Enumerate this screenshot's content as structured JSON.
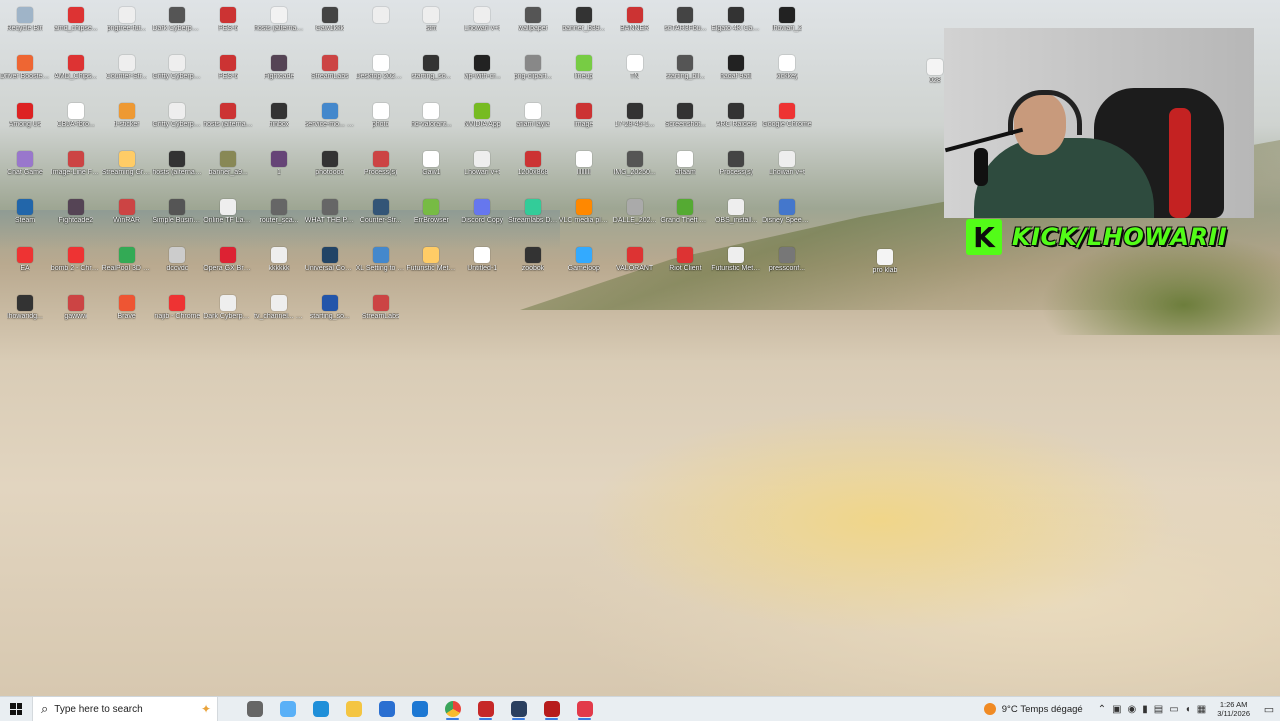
{
  "desktop": {
    "icons": [
      {
        "label": "Recycle Bin",
        "color": "#9fb4c8"
      },
      {
        "label": "amd_chipse...",
        "color": "#d33"
      },
      {
        "label": "pngtree-fut...",
        "color": "#eee"
      },
      {
        "label": "Dark Cyberpunk",
        "color": "#555"
      },
      {
        "label": "PES-6",
        "color": "#c33"
      },
      {
        "label": "hosts (alternative...",
        "color": "#f2f2f2"
      },
      {
        "label": "Gaw1kkk",
        "color": "#444"
      },
      {
        "label": "",
        "color": "#eee"
      },
      {
        "label": "stm",
        "color": "#eee"
      },
      {
        "label": "Lhowari v+t",
        "color": "#eee"
      },
      {
        "label": "wallpaper",
        "color": "#555"
      },
      {
        "label": "banner_b39...",
        "color": "#333"
      },
      {
        "label": "BANNER",
        "color": "#c33"
      },
      {
        "label": "scTAR3Fbu...",
        "color": "#444"
      },
      {
        "label": "Elgato 4K Captur...",
        "color": "#333"
      },
      {
        "label": "lhowari_2",
        "color": "#222"
      },
      {
        "label": "Driver Booster 12",
        "color": "#e63"
      },
      {
        "label": "AMD_Chips...",
        "color": "#d33"
      },
      {
        "label": "Counter-Str...",
        "color": "#eee"
      },
      {
        "label": "Gritty Cyberpunk",
        "color": "#eee"
      },
      {
        "label": "PES-6",
        "color": "#c33"
      },
      {
        "label": "Fightcade",
        "color": "#545"
      },
      {
        "label": "StreamLabs",
        "color": "#c44"
      },
      {
        "label": "Desktop 2025.04.0...",
        "color": "#fff"
      },
      {
        "label": "starting_so...",
        "color": "#333"
      },
      {
        "label": "vip-with-cr...",
        "color": "#222"
      },
      {
        "label": "png-clipart...",
        "color": "#888"
      },
      {
        "label": "lineup",
        "color": "#7c4"
      },
      {
        "label": "TN",
        "color": "#fff"
      },
      {
        "label": "starting_bil...",
        "color": "#555"
      },
      {
        "label": "hadaf 9atil",
        "color": "#222"
      },
      {
        "label": "kickkey",
        "color": "#fff"
      },
      {
        "label": "Among Us",
        "color": "#d22"
      },
      {
        "label": "CBJA-fbro...",
        "color": "#fff"
      },
      {
        "label": "tl-sticker",
        "color": "#e93"
      },
      {
        "label": "Gritty Cyberpunk...",
        "color": "#eee"
      },
      {
        "label": "hosts (alternative...",
        "color": "#c33"
      },
      {
        "label": "hinbox",
        "color": "#333"
      },
      {
        "label": "service-mo... (1)",
        "color": "#48c"
      },
      {
        "label": "photo",
        "color": "#fff"
      },
      {
        "label": "hd-valorant...",
        "color": "#fff"
      },
      {
        "label": "NVIDIA App",
        "color": "#7b2"
      },
      {
        "label": "aflam layla",
        "color": "#fff"
      },
      {
        "label": "image",
        "color": "#c33"
      },
      {
        "label": "17-28-45-1...",
        "color": "#333"
      },
      {
        "label": "Screenshot...",
        "color": "#333"
      },
      {
        "label": "ARC Raiders",
        "color": "#333"
      },
      {
        "label": "Google Chrome",
        "color": "#e33"
      },
      {
        "label": "Chat Game",
        "color": "#97c"
      },
      {
        "label": "Image-Line FL Studio",
        "color": "#c44"
      },
      {
        "label": "Streaming Grid Island",
        "color": "#fc6"
      },
      {
        "label": "hosts (alternative...",
        "color": "#333"
      },
      {
        "label": "banner_a9...",
        "color": "#885"
      },
      {
        "label": "1",
        "color": "#647"
      },
      {
        "label": "photoooo",
        "color": "#333"
      },
      {
        "label": "Process(s)",
        "color": "#c44"
      },
      {
        "label": "Gaw1",
        "color": "#fff"
      },
      {
        "label": "Lhowari v+t",
        "color": "#eee"
      },
      {
        "label": "1200x868",
        "color": "#c33"
      },
      {
        "label": "lllllllll",
        "color": "#fff"
      },
      {
        "label": "IMG_20250...",
        "color": "#555"
      },
      {
        "label": "aflaam",
        "color": "#fff"
      },
      {
        "label": "Process(s)",
        "color": "#444"
      },
      {
        "label": "Lhowari v+t",
        "color": "#eee"
      },
      {
        "label": "Steam",
        "color": "#26a"
      },
      {
        "label": "Fightcade2",
        "color": "#545"
      },
      {
        "label": "WinRAR",
        "color": "#c44"
      },
      {
        "label": "Simple Business Te...",
        "color": "#555"
      },
      {
        "label": "Online TF Launcher",
        "color": "#eee"
      },
      {
        "label": "router_sca...",
        "color": "#666"
      },
      {
        "label": "WHAT THE PAK",
        "color": "#666"
      },
      {
        "label": "Counter-Str...",
        "color": "#357"
      },
      {
        "label": "ErrBrowser",
        "color": "#7b4"
      },
      {
        "label": "Discord Copy",
        "color": "#67e"
      },
      {
        "label": "Streamlabs Desktop",
        "color": "#3c9"
      },
      {
        "label": "VLC media player",
        "color": "#f80"
      },
      {
        "label": "DALLE_202...",
        "color": "#aaa"
      },
      {
        "label": "Grand Theft Auto V Le...",
        "color": "#5a3"
      },
      {
        "label": "OBS_install...",
        "color": "#eee"
      },
      {
        "label": "Disney Speedstorm",
        "color": "#47c"
      },
      {
        "label": "EA",
        "color": "#e33"
      },
      {
        "label": "bomb 2 - Chrome",
        "color": "#e33"
      },
      {
        "label": "RealPool 3D - Poolians",
        "color": "#3a5"
      },
      {
        "label": "dccvdc",
        "color": "#ccc"
      },
      {
        "label": "Opera GX Browser",
        "color": "#d23"
      },
      {
        "label": "kkkkkk",
        "color": "#eee"
      },
      {
        "label": "Universal Control",
        "color": "#246"
      },
      {
        "label": "XL Setting to Share_v1.0...",
        "color": "#48c"
      },
      {
        "label": "Futuristic Metal Corn...",
        "color": "#fc6"
      },
      {
        "label": "Untitled-1",
        "color": "#fff"
      },
      {
        "label": "zoobok",
        "color": "#333"
      },
      {
        "label": "Gameloop",
        "color": "#3af"
      },
      {
        "label": "VALORANT",
        "color": "#d33"
      },
      {
        "label": "Riot Client",
        "color": "#d33"
      },
      {
        "label": "Futuristic Metal Corn...",
        "color": "#eee"
      },
      {
        "label": "pressconf...",
        "color": "#777"
      },
      {
        "label": "lhowaridg...",
        "color": "#333"
      },
      {
        "label": "gawww",
        "color": "#c44"
      },
      {
        "label": "Brave",
        "color": "#e53"
      },
      {
        "label": "najib - Chrome",
        "color": "#e33"
      },
      {
        "label": "Dark Cyberpunk",
        "color": "#eee"
      },
      {
        "label": "tv_channel... (1)",
        "color": "#eee"
      },
      {
        "label": "starting_so...",
        "color": "#25a"
      },
      {
        "label": "StreamLabs",
        "color": "#c44"
      }
    ],
    "extra_labels": [
      "pro klab",
      "028"
    ]
  },
  "stream_overlay": {
    "logo_letter": "K",
    "text": "KICK/LHOWARII"
  },
  "taskbar": {
    "search_placeholder": "Type here to search",
    "apps": [
      {
        "name": "task-view-icon",
        "color": "#666",
        "active": false
      },
      {
        "name": "copilot-icon",
        "color": "#5ab0f7",
        "active": false
      },
      {
        "name": "edge-icon",
        "color": "#1f8fd9",
        "active": false
      },
      {
        "name": "file-explorer-icon",
        "color": "#f4c542",
        "active": false
      },
      {
        "name": "microsoft-store-icon",
        "color": "#2a6fd1",
        "active": false
      },
      {
        "name": "outlook-icon",
        "color": "#1d78d3",
        "active": false
      },
      {
        "name": "chrome-icon",
        "color": "#e8453c",
        "active": true
      },
      {
        "name": "obs-icon",
        "color": "#c62828",
        "active": true
      },
      {
        "name": "elgato-icon",
        "color": "#2a3f5f",
        "active": true
      },
      {
        "name": "recording-icon",
        "color": "#b71c1c",
        "active": true
      },
      {
        "name": "capcut-icon",
        "color": "#e23a4a",
        "active": true
      }
    ],
    "weather": {
      "temp": "9°C",
      "text": "Temps dégagé"
    },
    "clock": {
      "time": "1:26 AM",
      "date": "3/11/2026"
    }
  }
}
